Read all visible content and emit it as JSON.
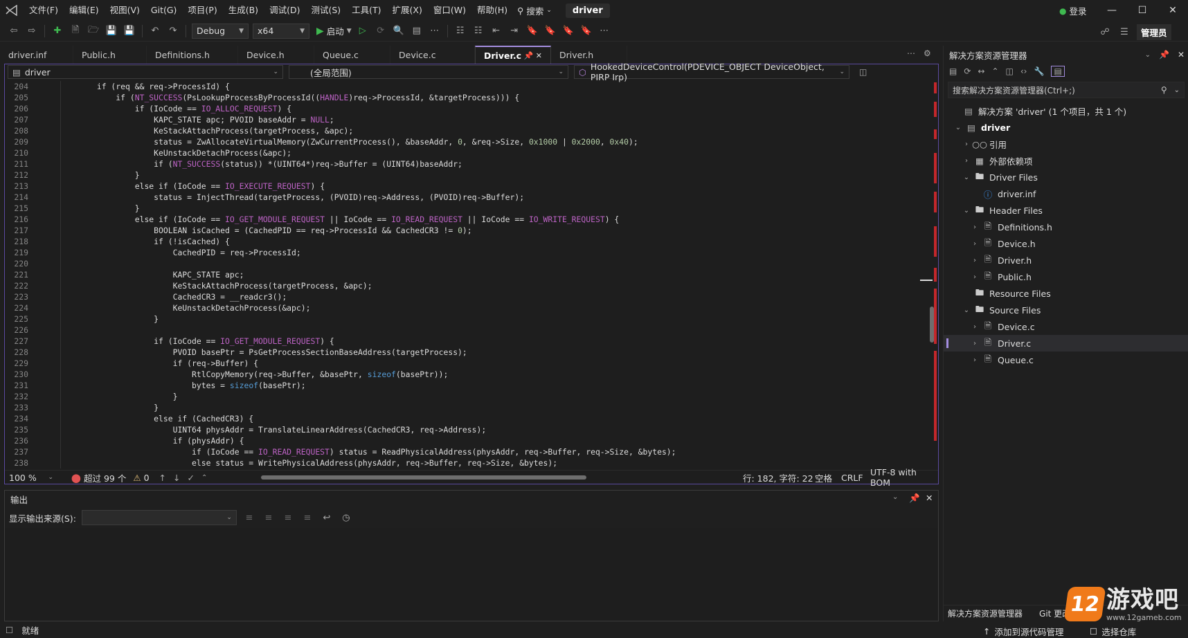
{
  "menubar": {
    "items": [
      "文件(F)",
      "编辑(E)",
      "视图(V)",
      "Git(G)",
      "项目(P)",
      "生成(B)",
      "调试(D)",
      "测试(S)",
      "工具(T)",
      "扩展(X)",
      "窗口(W)",
      "帮助(H)"
    ],
    "search_label": "搜索",
    "solution_name": "driver",
    "login_label": "登录"
  },
  "toolbar": {
    "config": "Debug",
    "platform": "x64",
    "start_label": "启动",
    "admin_label": "管理员"
  },
  "tabs": [
    {
      "label": "driver.inf"
    },
    {
      "label": "Public.h"
    },
    {
      "label": "Definitions.h"
    },
    {
      "label": "Device.h"
    },
    {
      "label": "Queue.c"
    },
    {
      "label": "Device.c"
    },
    {
      "label": "Driver.c",
      "active": true
    },
    {
      "label": "Driver.h"
    }
  ],
  "navbar": {
    "project": "driver",
    "scope": "(全局范围)",
    "function": "HookedDeviceControl(PDEVICE_OBJECT DeviceObject, PIRP Irp)"
  },
  "code": {
    "lines": [
      {
        "n": "204",
        "t": "        if (req && req->ProcessId) {"
      },
      {
        "n": "205",
        "t": "            if (NT_SUCCESS(PsLookupProcessByProcessId((HANDLE)req->ProcessId, &targetProcess))) {"
      },
      {
        "n": "206",
        "t": "                if (IoCode == IO_ALLOC_REQUEST) {"
      },
      {
        "n": "207",
        "t": "                    KAPC_STATE apc; PVOID baseAddr = NULL;"
      },
      {
        "n": "208",
        "t": "                    KeStackAttachProcess(targetProcess, &apc);"
      },
      {
        "n": "209",
        "t": "                    status = ZwAllocateVirtualMemory(ZwCurrentProcess(), &baseAddr, 0, &req->Size, 0x1000 | 0x2000, 0x40);"
      },
      {
        "n": "210",
        "t": "                    KeUnstackDetachProcess(&apc);"
      },
      {
        "n": "211",
        "t": "                    if (NT_SUCCESS(status)) *(UINT64*)req->Buffer = (UINT64)baseAddr;"
      },
      {
        "n": "212",
        "t": "                }"
      },
      {
        "n": "213",
        "t": "                else if (IoCode == IO_EXECUTE_REQUEST) {"
      },
      {
        "n": "214",
        "t": "                    status = InjectThread(targetProcess, (PVOID)req->Address, (PVOID)req->Buffer);"
      },
      {
        "n": "215",
        "t": "                }"
      },
      {
        "n": "216",
        "t": "                else if (IoCode == IO_GET_MODULE_REQUEST || IoCode == IO_READ_REQUEST || IoCode == IO_WRITE_REQUEST) {"
      },
      {
        "n": "217",
        "t": "                    BOOLEAN isCached = (CachedPID == req->ProcessId && CachedCR3 != 0);"
      },
      {
        "n": "218",
        "t": "                    if (!isCached) {"
      },
      {
        "n": "219",
        "t": "                        CachedPID = req->ProcessId;"
      },
      {
        "n": "220",
        "t": ""
      },
      {
        "n": "221",
        "t": "                        KAPC_STATE apc;"
      },
      {
        "n": "222",
        "t": "                        KeStackAttachProcess(targetProcess, &apc);"
      },
      {
        "n": "223",
        "t": "                        CachedCR3 = __readcr3();"
      },
      {
        "n": "224",
        "t": "                        KeUnstackDetachProcess(&apc);"
      },
      {
        "n": "225",
        "t": "                    }"
      },
      {
        "n": "226",
        "t": ""
      },
      {
        "n": "227",
        "t": "                    if (IoCode == IO_GET_MODULE_REQUEST) {"
      },
      {
        "n": "228",
        "t": "                        PVOID basePtr = PsGetProcessSectionBaseAddress(targetProcess);"
      },
      {
        "n": "229",
        "t": "                        if (req->Buffer) {"
      },
      {
        "n": "230",
        "t": "                            RtlCopyMemory(req->Buffer, &basePtr, sizeof(basePtr));"
      },
      {
        "n": "231",
        "t": "                            bytes = sizeof(basePtr);"
      },
      {
        "n": "232",
        "t": "                        }"
      },
      {
        "n": "233",
        "t": "                    }"
      },
      {
        "n": "234",
        "t": "                    else if (CachedCR3) {"
      },
      {
        "n": "235",
        "t": "                        UINT64 physAddr = TranslateLinearAddress(CachedCR3, req->Address);"
      },
      {
        "n": "236",
        "t": "                        if (physAddr) {"
      },
      {
        "n": "237",
        "t": "                            if (IoCode == IO_READ_REQUEST) status = ReadPhysicalAddress(physAddr, req->Buffer, req->Size, &bytes);"
      },
      {
        "n": "238",
        "t": "                            else status = WritePhysicalAddress(physAddr, req->Buffer, req->Size, &bytes);"
      }
    ]
  },
  "editor_status": {
    "zoom": "100 %",
    "errors": "超过 99 个",
    "warnings": "0",
    "position": "行: 182, 字符: 22",
    "whitespace": "空格",
    "line_ending": "CRLF",
    "encoding": "UTF-8 with BOM"
  },
  "output": {
    "title": "输出",
    "source_label": "显示输出来源(S):"
  },
  "solution_explorer": {
    "title": "解决方案资源管理器",
    "search_placeholder": "搜索解决方案资源管理器(Ctrl+;)",
    "solution_label": "解决方案 'driver' (1 个项目，共 1 个)",
    "project": "driver",
    "nodes": [
      {
        "label": "引用",
        "icon": "references-icon"
      },
      {
        "label": "外部依赖项",
        "icon": "external-deps-icon"
      },
      {
        "label": "Driver Files",
        "icon": "filter-folder-icon"
      },
      {
        "label": "driver.inf",
        "icon": "info-file-icon"
      },
      {
        "label": "Header Files",
        "icon": "filter-folder-icon"
      },
      {
        "label": "Definitions.h",
        "icon": "header-file-icon"
      },
      {
        "label": "Device.h",
        "icon": "header-file-icon"
      },
      {
        "label": "Driver.h",
        "icon": "header-file-icon"
      },
      {
        "label": "Public.h",
        "icon": "header-file-icon"
      },
      {
        "label": "Resource Files",
        "icon": "filter-folder-icon"
      },
      {
        "label": "Source Files",
        "icon": "filter-folder-icon"
      },
      {
        "label": "Device.c",
        "icon": "source-file-icon"
      },
      {
        "label": "Driver.c",
        "icon": "source-file-icon"
      },
      {
        "label": "Queue.c",
        "icon": "source-file-icon"
      }
    ],
    "bottom_tabs": [
      "解决方案资源管理器",
      "Git 更改"
    ]
  },
  "statusbar": {
    "ready": "就绪",
    "add_source_control": "添加到源代码管理",
    "select_repo": "选择仓库"
  },
  "watermark": {
    "logo_number": "12",
    "logo_text": "游戏吧",
    "url": "www.12gameb.com"
  },
  "colors": {
    "accent": "#a48ee0",
    "error_red": "#c3272b",
    "start_green": "#3fb950"
  }
}
